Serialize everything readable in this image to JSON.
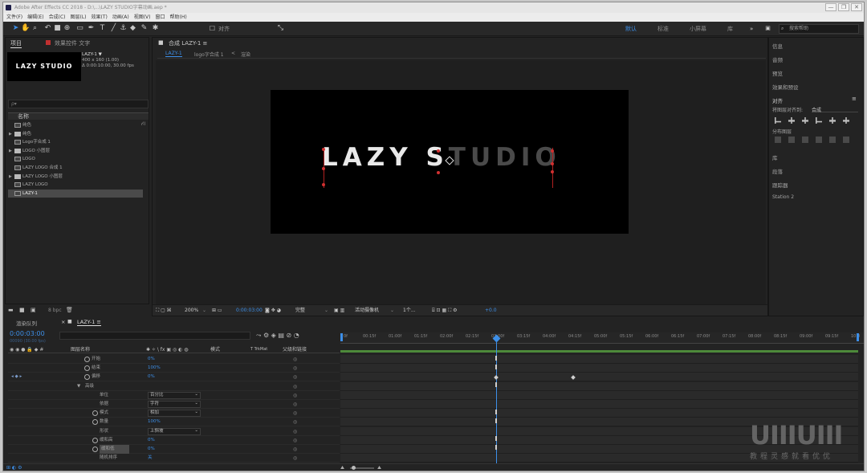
{
  "window": {
    "title": "Adobe After Effects CC 2018 - D:\\...\\LAZY STUDIO字幕动画.aep *",
    "controls": [
      "—",
      "❐",
      "✕"
    ]
  },
  "menu": [
    "文件(F)",
    "编辑(E)",
    "合成(C)",
    "图层(L)",
    "效果(T)",
    "动画(A)",
    "视图(V)",
    "窗口",
    "帮助(H)"
  ],
  "toolbar": {
    "snap_label": "对齐",
    "workspaces": [
      "默认",
      "标准",
      "小屏幕",
      "库"
    ],
    "active_workspace": "默认",
    "search_placeholder": "搜索帮助"
  },
  "project_panel": {
    "tabs": [
      "项目",
      "效果控件 文字"
    ],
    "selected_name": "LAZY-1 ▼",
    "selected_info": [
      "400 x 160 (1.00)",
      "Δ 0:00:10:00, 30.00 fps"
    ],
    "thumb_text": "LAZY STUDIO",
    "search_placeholder": "ρ▾",
    "column_name": "名称",
    "items": [
      {
        "name": "纯色",
        "type": "comp"
      },
      {
        "name": "纯色",
        "type": "folder"
      },
      {
        "name": "Logo字合成 1",
        "type": "comp"
      },
      {
        "name": "LOGO 小图层",
        "type": "folder"
      },
      {
        "name": "LOGO",
        "type": "comp"
      },
      {
        "name": "LAZY LOGO 合成 1",
        "type": "comp"
      },
      {
        "name": "LAZY LOGO 小图层",
        "type": "folder"
      },
      {
        "name": "LAZY LOGO",
        "type": "comp"
      },
      {
        "name": "LAZY-1",
        "type": "comp",
        "selected": true
      }
    ],
    "footer_bpc": "8 bpc"
  },
  "comp_panel": {
    "tab": "合成 LAZY-1 ≡",
    "breadcrumbs": [
      "LAZY-1",
      "logo字合成 1",
      "<",
      "渲染"
    ],
    "canvas_text_a": "LAZY S",
    "canvas_text_b": "TUDIO",
    "zoom": "200%",
    "timecode": "0:00:03:00",
    "resolution": "完整",
    "camera": "活动摄像机",
    "views": "1个...",
    "exposure": "+0.0"
  },
  "right_panel": {
    "items": [
      "信息",
      "音频",
      "预览",
      "效果和预设"
    ],
    "align_title": "对齐",
    "align_to_label": "将图层对齐到:",
    "align_to_value": "合成",
    "distribute_label": "分布图层",
    "extra_items": [
      "库",
      "段落",
      "跟踪器",
      "Station 2"
    ]
  },
  "timeline": {
    "tabs": [
      "渲染队列",
      "LAZY-1 ≡"
    ],
    "current_time": "0:00:03:00",
    "frame_info": "00090 (30.00 fps)",
    "col_headers": [
      "图层名称",
      "模式",
      "T TrkMat",
      "父级和链接"
    ],
    "ruler": [
      "0f",
      "00:15f",
      "01:00f",
      "01:15f",
      "02:00f",
      "02:15f",
      "03:00f",
      "03:15f",
      "04:00f",
      "04:15f",
      "05:00f",
      "05:15f",
      "06:00f",
      "06:15f",
      "07:00f",
      "07:15f",
      "08:00f",
      "08:15f",
      "09:00f",
      "09:15f",
      "10:0"
    ],
    "rows": [
      {
        "label": "开始",
        "value": "0%",
        "indent": 1,
        "stopwatch": true
      },
      {
        "label": "结束",
        "value": "100%",
        "indent": 1,
        "stopwatch": true
      },
      {
        "label": "偏移",
        "value": "0%",
        "indent": 1,
        "stopwatch": true
      },
      {
        "label": "高级",
        "value": "",
        "indent": 0,
        "twirl": true
      },
      {
        "label": "单位",
        "value": "",
        "indent": 2,
        "dropdown": "百分比"
      },
      {
        "label": "依据",
        "value": "",
        "indent": 2,
        "dropdown": "字符"
      },
      {
        "label": "模式",
        "value": "",
        "indent": 2,
        "dropdown": "相加",
        "stopwatch": true
      },
      {
        "label": "数量",
        "value": "100%",
        "indent": 2,
        "stopwatch": true
      },
      {
        "label": "形状",
        "value": "",
        "indent": 2,
        "dropdown": "上斜坡"
      },
      {
        "label": "缓和高",
        "value": "0%",
        "indent": 2,
        "stopwatch": true
      },
      {
        "label": "缓和低",
        "value": "0%",
        "indent": 2,
        "stopwatch": true
      },
      {
        "label": "随机排序",
        "value": "关",
        "indent": 2
      }
    ]
  },
  "watermark": {
    "logo": "UIIIUIII",
    "sub": "教程灵感就看优优"
  }
}
